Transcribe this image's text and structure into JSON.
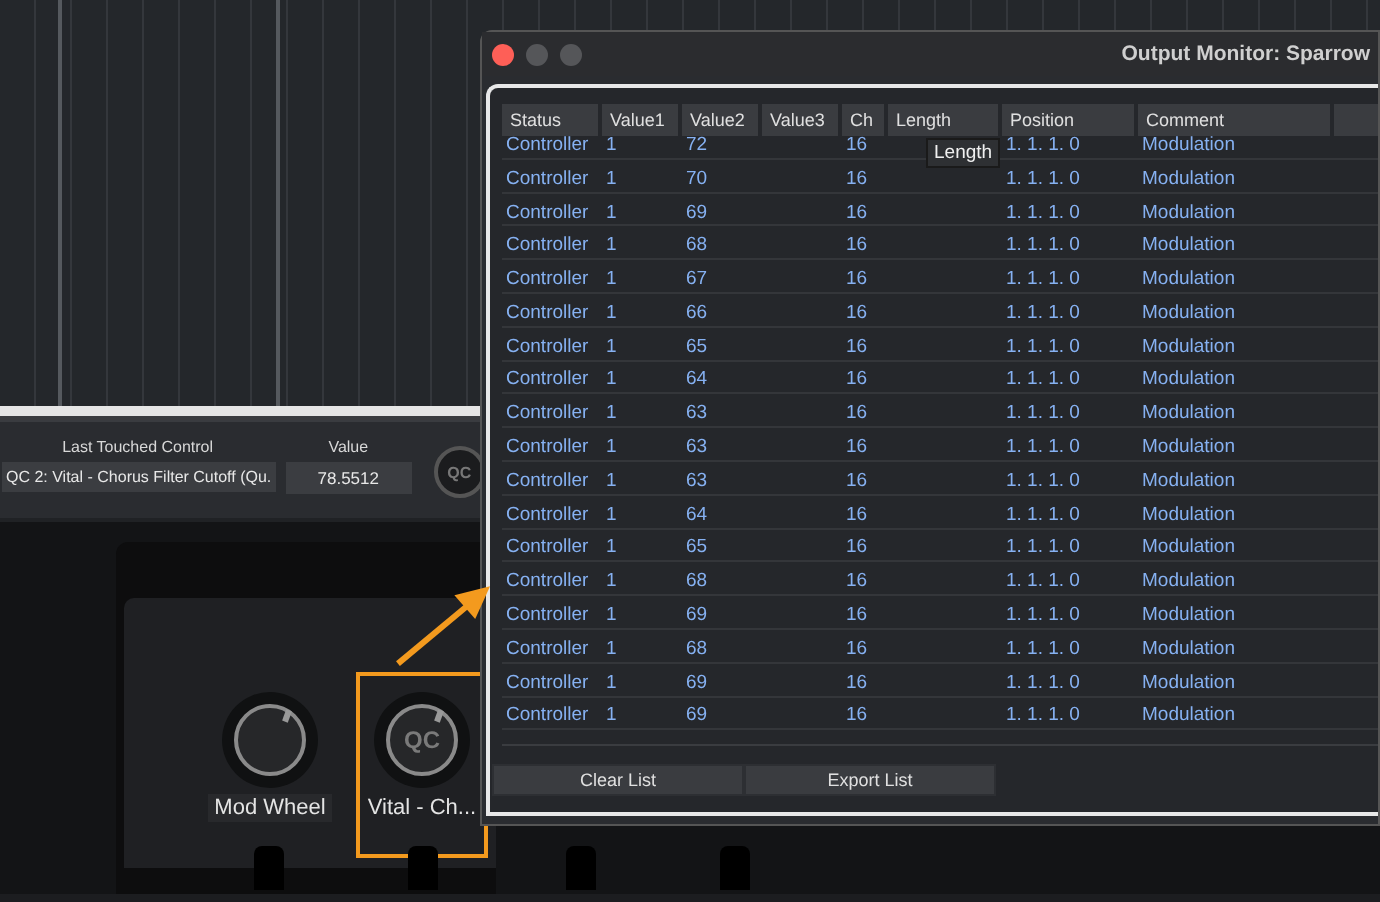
{
  "control_bar": {
    "last_touched_label": "Last Touched Control",
    "value_label": "Value",
    "last_touched": "QC 2: Vital - Chorus Filter Cutoff (Qu.",
    "value": "78.5512",
    "qc_button": "QC"
  },
  "knobs": [
    {
      "kind": "plain",
      "label": "Mod Wheel",
      "highlighted": false
    },
    {
      "kind": "qc",
      "face": "QC",
      "label": "Vital - Ch...",
      "highlighted": true
    }
  ],
  "window": {
    "title": "Output Monitor: Sparrow",
    "columns": [
      "Status",
      "Value1",
      "Value2",
      "Value3",
      "Ch",
      "Length",
      "Position",
      "Comment"
    ],
    "rows": [
      {
        "status": "Controller",
        "value1": "1",
        "value2": "72",
        "ch": "16",
        "position": "1. 1. 1. 0",
        "comment": "Modulation"
      },
      {
        "status": "Controller",
        "value1": "1",
        "value2": "70",
        "ch": "16",
        "position": "1. 1. 1. 0",
        "comment": "Modulation"
      },
      {
        "status": "Controller",
        "value1": "1",
        "value2": "69",
        "ch": "16",
        "position": "1. 1. 1. 0",
        "comment": "Modulation"
      },
      {
        "status": "Controller",
        "value1": "1",
        "value2": "68",
        "ch": "16",
        "position": "1. 1. 1. 0",
        "comment": "Modulation"
      },
      {
        "status": "Controller",
        "value1": "1",
        "value2": "67",
        "ch": "16",
        "position": "1. 1. 1. 0",
        "comment": "Modulation"
      },
      {
        "status": "Controller",
        "value1": "1",
        "value2": "66",
        "ch": "16",
        "position": "1. 1. 1. 0",
        "comment": "Modulation"
      },
      {
        "status": "Controller",
        "value1": "1",
        "value2": "65",
        "ch": "16",
        "position": "1. 1. 1. 0",
        "comment": "Modulation"
      },
      {
        "status": "Controller",
        "value1": "1",
        "value2": "64",
        "ch": "16",
        "position": "1. 1. 1. 0",
        "comment": "Modulation"
      },
      {
        "status": "Controller",
        "value1": "1",
        "value2": "63",
        "ch": "16",
        "position": "1. 1. 1. 0",
        "comment": "Modulation"
      },
      {
        "status": "Controller",
        "value1": "1",
        "value2": "63",
        "ch": "16",
        "position": "1. 1. 1. 0",
        "comment": "Modulation"
      },
      {
        "status": "Controller",
        "value1": "1",
        "value2": "63",
        "ch": "16",
        "position": "1. 1. 1. 0",
        "comment": "Modulation"
      },
      {
        "status": "Controller",
        "value1": "1",
        "value2": "64",
        "ch": "16",
        "position": "1. 1. 1. 0",
        "comment": "Modulation"
      },
      {
        "status": "Controller",
        "value1": "1",
        "value2": "65",
        "ch": "16",
        "position": "1. 1. 1. 0",
        "comment": "Modulation"
      },
      {
        "status": "Controller",
        "value1": "1",
        "value2": "68",
        "ch": "16",
        "position": "1. 1. 1. 0",
        "comment": "Modulation"
      },
      {
        "status": "Controller",
        "value1": "1",
        "value2": "69",
        "ch": "16",
        "position": "1. 1. 1. 0",
        "comment": "Modulation"
      },
      {
        "status": "Controller",
        "value1": "1",
        "value2": "68",
        "ch": "16",
        "position": "1. 1. 1. 0",
        "comment": "Modulation"
      },
      {
        "status": "Controller",
        "value1": "1",
        "value2": "69",
        "ch": "16",
        "position": "1. 1. 1. 0",
        "comment": "Modulation"
      },
      {
        "status": "Controller",
        "value1": "1",
        "value2": "69",
        "ch": "16",
        "position": "1. 1. 1. 0",
        "comment": "Modulation"
      }
    ],
    "tooltip": "Length",
    "buttons": [
      "Clear List",
      "Export List"
    ]
  }
}
